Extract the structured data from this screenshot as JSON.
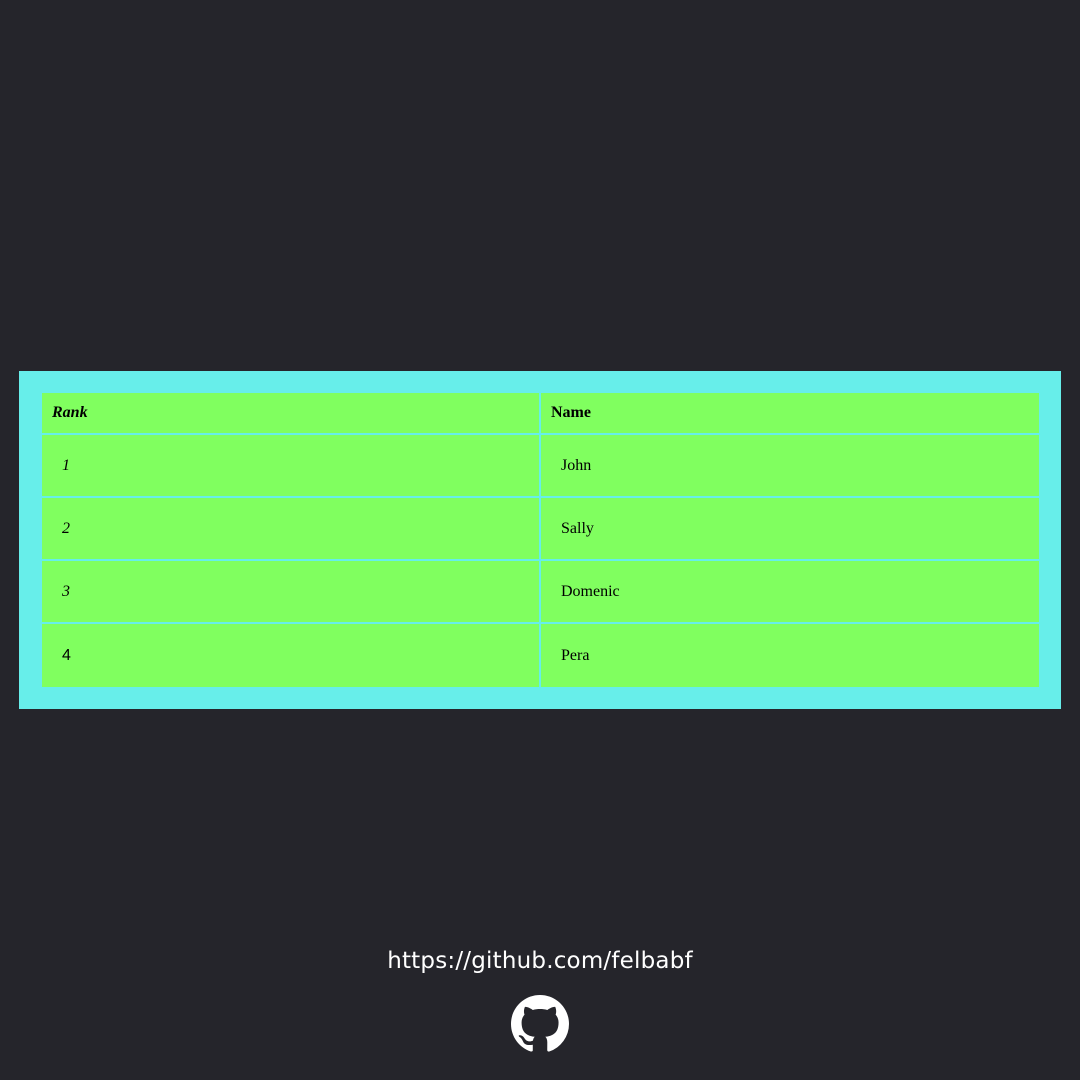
{
  "table": {
    "headers": {
      "rank": "Rank",
      "name": "Name"
    },
    "rows": [
      {
        "rank": "1",
        "name": "John"
      },
      {
        "rank": "2",
        "name": "Sally"
      },
      {
        "rank": "3",
        "name": "Domenic"
      },
      {
        "rank": "4",
        "name": "Pera"
      }
    ]
  },
  "footer": {
    "link_text": "https://github.com/felbabf",
    "icon": "github-icon"
  },
  "colors": {
    "background": "#25252b",
    "table_frame": "#67eeea",
    "cell": "#80ff5f",
    "footer_text": "#ffffff"
  }
}
